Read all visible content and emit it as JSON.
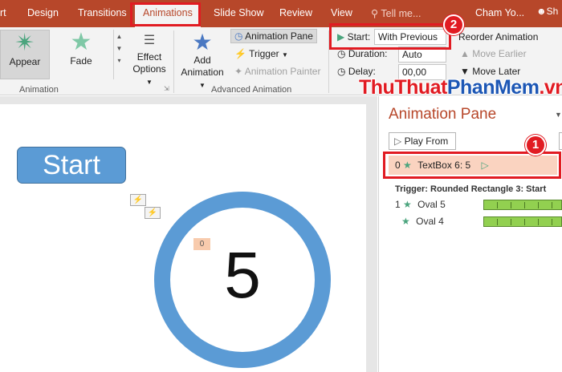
{
  "tabs": {
    "prev_partial": "rt",
    "design": "Design",
    "transitions": "Transitions",
    "animations": "Animations",
    "slideshow": "Slide Show",
    "review": "Review",
    "view": "View",
    "tell_me": "Tell me...",
    "user": "Cham Yo...",
    "share": "Sh"
  },
  "animation_gallery": {
    "items": [
      {
        "label": "Appear",
        "icon": "star-burst-icon",
        "selected": true
      },
      {
        "label": "Fade",
        "icon": "star-icon",
        "selected": false
      }
    ],
    "effect_options_line1": "Effect",
    "effect_options_line2": "Options",
    "group_label": "Animation"
  },
  "advanced": {
    "add_animation_line1": "Add",
    "add_animation_line2": "Animation",
    "animation_pane": "Animation Pane",
    "trigger": "Trigger",
    "animation_painter": "Animation Painter",
    "group_label": "Advanced Animation"
  },
  "timing": {
    "start_label": "Start:",
    "start_value": "With Previous",
    "duration_label": "Duration:",
    "duration_value": "Auto",
    "delay_label": "Delay:",
    "delay_value": "00,00",
    "reorder": "Reorder Animation",
    "move_earlier": "Move Earlier",
    "move_later": "Move Later"
  },
  "callouts": {
    "one": "1",
    "two": "2"
  },
  "watermark": {
    "part1": "ThuThuat",
    "part2": "PhanMem",
    "part3": ".vn"
  },
  "slide": {
    "start_button": "Start",
    "number": "5",
    "anim_tag": "0"
  },
  "pane": {
    "title": "Animation Pane",
    "play_from": "Play From",
    "selected_row": {
      "order": "0",
      "name": "TextBox 6: 5"
    },
    "trigger": "Trigger: Rounded Rectangle 3: Start",
    "rows": [
      {
        "order": "1",
        "name": "Oval 5"
      },
      {
        "order": "",
        "name": "Oval 4"
      }
    ]
  },
  "colors": {
    "accent": "#b7472a",
    "callout": "#e11b22",
    "shape": "#5b9bd5",
    "timeline": "#92d050"
  }
}
